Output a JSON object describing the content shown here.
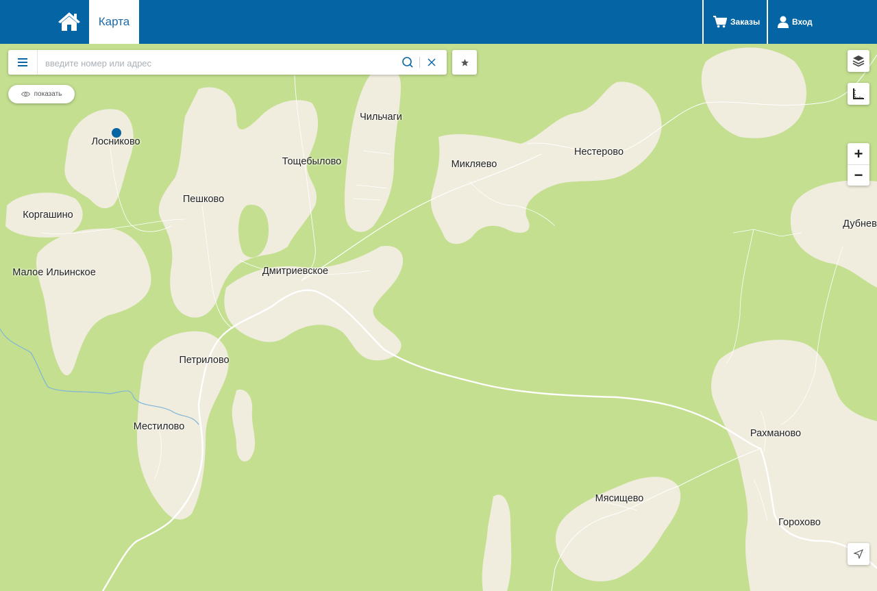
{
  "header": {
    "tab_map": "Карта",
    "orders_label": "Заказы",
    "login_label": "Вход",
    "icons": {
      "home": "home-icon",
      "cart": "cart-icon",
      "user": "user-icon"
    }
  },
  "search": {
    "placeholder": "введите номер или адрес"
  },
  "show_button": {
    "label": "показать"
  },
  "controls": {
    "zoom_in": "+",
    "zoom_out": "−"
  },
  "map": {
    "colors": {
      "forest": "#c3df8f",
      "settlement": "#f0ecde",
      "road": "#ffffff",
      "river": "#7fb6d8",
      "accent": "#0564a4"
    },
    "places": [
      {
        "name": "Лосниково"
      },
      {
        "name": "Чильчаги"
      },
      {
        "name": "Тощебылово"
      },
      {
        "name": "Микляево"
      },
      {
        "name": "Нестерово"
      },
      {
        "name": "Пешково"
      },
      {
        "name": "Коргашино"
      },
      {
        "name": "Дубнев"
      },
      {
        "name": "Малое Ильинское"
      },
      {
        "name": "Дмитриевское"
      },
      {
        "name": "Петрилово"
      },
      {
        "name": "Местилово"
      },
      {
        "name": "Рахманово"
      },
      {
        "name": "Мясищево"
      },
      {
        "name": "Горохово"
      }
    ]
  }
}
